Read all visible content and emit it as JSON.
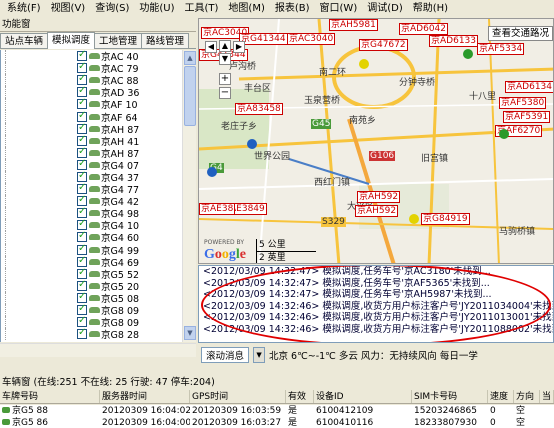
{
  "menu": [
    "系统(F)",
    "视图(V)",
    "查询(S)",
    "功能(U)",
    "工具(T)",
    "地图(M)",
    "报表(B)",
    "窗口(W)",
    "调试(D)",
    "帮助(H)"
  ],
  "function_window": {
    "title": "功能窗",
    "tabs": [
      "站点车辆",
      "模拟调度",
      "工地管理",
      "路线管理"
    ],
    "active_tab": 1
  },
  "vehicles": [
    {
      "prefix": "京AC",
      "suffix": "40"
    },
    {
      "prefix": "京AC",
      "suffix": "79"
    },
    {
      "prefix": "京AC",
      "suffix": "88"
    },
    {
      "prefix": "京AD",
      "suffix": "36"
    },
    {
      "prefix": "京AF",
      "suffix": "10"
    },
    {
      "prefix": "京AF",
      "suffix": "64"
    },
    {
      "prefix": "京AH",
      "suffix": "87"
    },
    {
      "prefix": "京AH",
      "suffix": "41"
    },
    {
      "prefix": "京AH",
      "suffix": "87"
    },
    {
      "prefix": "京G4",
      "suffix": "07"
    },
    {
      "prefix": "京G4",
      "suffix": "37"
    },
    {
      "prefix": "京G4",
      "suffix": "77"
    },
    {
      "prefix": "京G4",
      "suffix": "42"
    },
    {
      "prefix": "京G4",
      "suffix": "98"
    },
    {
      "prefix": "京G4",
      "suffix": "10"
    },
    {
      "prefix": "京G4",
      "suffix": "60"
    },
    {
      "prefix": "京G4",
      "suffix": "99"
    },
    {
      "prefix": "京G4",
      "suffix": "69"
    },
    {
      "prefix": "京G5",
      "suffix": "52"
    },
    {
      "prefix": "京G5",
      "suffix": "20"
    },
    {
      "prefix": "京G5",
      "suffix": "08"
    },
    {
      "prefix": "京G8",
      "suffix": "09"
    },
    {
      "prefix": "京G8",
      "suffix": "09"
    },
    {
      "prefix": "京G8",
      "suffix": "28"
    }
  ],
  "map": {
    "view_streetview_button": "查看交通路况",
    "labels": [
      "卢沟桥",
      "丰台区",
      "南二环",
      "玉泉营桥",
      "分钟寺桥",
      "十八里",
      "老庄子乡",
      "世界公园",
      "南苑乡",
      "旧宫镇",
      "西红门镇",
      "大兴区",
      "马驹桥镇",
      "G45",
      "G106",
      "S329",
      "G4"
    ],
    "plates": [
      "京AC3040",
      "京G41344",
      "京AC3040",
      "京AH5981",
      "京G47672",
      "京AD6042",
      "京AD6133",
      "京AF5334",
      "京AF5380",
      "京AF5391",
      "京AD6134",
      "京G41344",
      "京A83458",
      "京AF6270",
      "京AE3849",
      "京AE38",
      "京AH592",
      "京AH592",
      "京G84919"
    ],
    "scale_km": "5 公里",
    "scale_mi": "2 英里",
    "google": "Google",
    "powered": "POWERED BY"
  },
  "messages": [
    "<2012/03/09 14:32:47>  模拟调度,任务车号'京AC3180'未找到...",
    "<2012/03/09 14:32:47>  模拟调度,任务车号'京AF5365'未找到...",
    "<2012/03/09 14:32:47>  模拟调度,任务车号'京AH5987'未找到...",
    "<2012/03/09 14:32:46>  模拟调度,收货方用户标注客户号'JY2011034004'未找到...",
    "<2012/03/09 14:32:46>  模拟调度,收货方用户标注客户号'JY2011013001'未找到...",
    "<2012/03/09 14:32:46>  模拟调度,收货方用户标注客户号'JY2011088002'未找到..."
  ],
  "bottom": {
    "dropdown_label": "滚动消息",
    "ticker": "北京 6℃~-1℃ 多云 风力：无持续风向    每日一学"
  },
  "vehicle_window": {
    "title": "车辆窗",
    "stats": "(在线:251 不在线: 25 行驶: 47 停车:204)",
    "columns": [
      "车牌号码",
      "服务器时间",
      "GPS时间",
      "有效",
      "设备ID",
      "SIM卡号码",
      "速度",
      "方向",
      "当"
    ],
    "rows": [
      [
        "京G5   88",
        "20120309 16:04:02",
        "20120309 16:03:59",
        "是",
        "6100412109",
        "15203246865",
        "0",
        "空",
        ""
      ],
      [
        "京G5   86",
        "20120309 16:04:00",
        "20120309 16:03:27",
        "是",
        "6100410116",
        "18233807930",
        "0",
        "空",
        ""
      ]
    ]
  }
}
